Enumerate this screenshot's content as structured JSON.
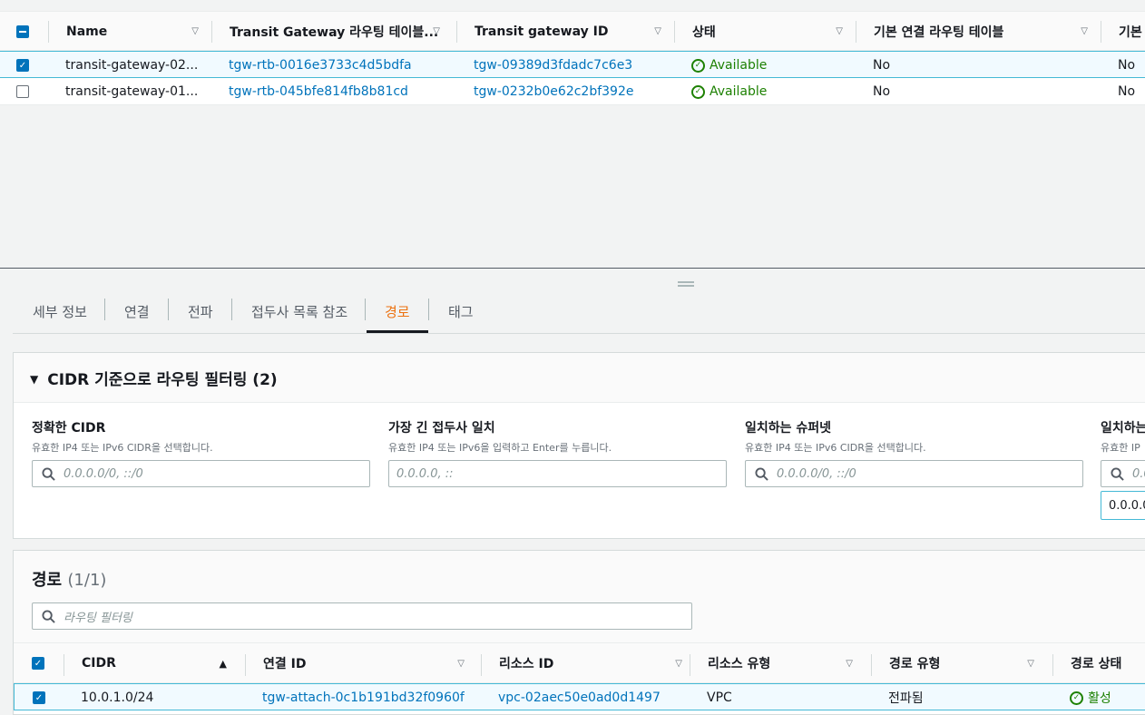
{
  "top_table": {
    "columns": [
      "Name",
      "Transit Gateway 라우팅 테이블...",
      "Transit gateway ID",
      "상태",
      "기본 연결 라우팅 테이블",
      "기본"
    ],
    "rows": [
      {
        "selected": true,
        "name": "transit-gateway-02...",
        "rtb_id": "tgw-rtb-0016e3733c4d5bdfa",
        "tgw_id": "tgw-09389d3fdadc7c6e3",
        "status": "Available",
        "default_assoc": "No",
        "default_prop": "No"
      },
      {
        "selected": false,
        "name": "transit-gateway-01...",
        "rtb_id": "tgw-rtb-045bfe814fb8b81cd",
        "tgw_id": "tgw-0232b0e62c2bf392e",
        "status": "Available",
        "default_assoc": "No",
        "default_prop": "No"
      }
    ]
  },
  "tabs": [
    "세부 정보",
    "연결",
    "전파",
    "접두사 목록 참조",
    "경로",
    "태그"
  ],
  "active_tab": "경로",
  "filter_panel": {
    "title": "CIDR 기준으로 라우팅 필터링 (2)",
    "filters": [
      {
        "label": "정확한 CIDR",
        "desc": "유효한 IP4 또는 IPv6 CIDR을 선택합니다.",
        "placeholder": "0.0.0.0/0, ::/0"
      },
      {
        "label": "가장 긴 접두사 일치",
        "desc": "유효한 IP4 또는 IPv6을 입력하고 Enter를 누릅니다.",
        "placeholder": "0.0.0.0, ::"
      },
      {
        "label": "일치하는 슈퍼넷",
        "desc": "유효한 IP4 또는 IPv6 CIDR을 선택합니다.",
        "placeholder": "0.0.0.0/0, ::/0"
      },
      {
        "label": "일치하는",
        "desc": "유효한 IP",
        "placeholder": "0.0"
      }
    ],
    "extra_token": "0.0.0.0"
  },
  "routes": {
    "title": "경로",
    "count": "(1/1)",
    "search_placeholder": "라우팅 필터링",
    "columns": [
      "CIDR",
      "연결 ID",
      "리소스 ID",
      "리소스 유형",
      "경로 유형",
      "경로 상태"
    ],
    "rows": [
      {
        "cidr": "10.0.1.0/24",
        "attachment_id": "tgw-attach-0c1b191bd32f0960f",
        "resource_id": "vpc-02aec50e0ad0d1497",
        "resource_type": "VPC",
        "route_type": "전파됨",
        "route_state": "활성"
      }
    ]
  },
  "colors": {
    "link": "#0073bb",
    "success": "#1d8102",
    "active_tab": "#ec7211",
    "selection_border": "#44b9d6"
  },
  "icons": [
    "checkbox-icon",
    "sort-icon",
    "status-ok-icon",
    "search-icon",
    "collapse-caret-icon",
    "drag-handle-icon"
  ]
}
